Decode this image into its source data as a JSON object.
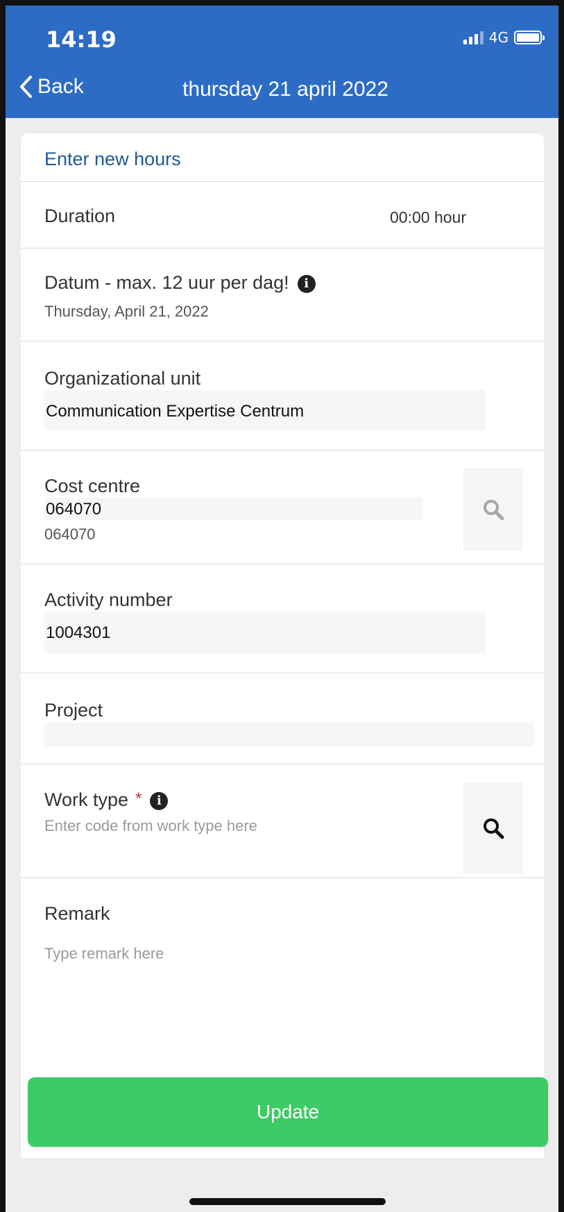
{
  "status": {
    "time": "14:19",
    "network": "4G"
  },
  "nav": {
    "back_label": "Back",
    "title": "thursday 21 april 2022"
  },
  "form": {
    "title": "Enter new hours",
    "duration": {
      "label": "Duration",
      "value": "00:00 hour"
    },
    "datum": {
      "label": "Datum - max. 12 uur per dag!",
      "value": "Thursday, April 21, 2022"
    },
    "org_unit": {
      "label": "Organizational unit",
      "value": "Communication Expertise Centrum"
    },
    "cost_centre": {
      "label": "Cost centre",
      "value": "064070",
      "description": "064070"
    },
    "activity": {
      "label": "Activity number",
      "value": "1004301"
    },
    "project": {
      "label": "Project",
      "value": ""
    },
    "work_type": {
      "label": "Work type",
      "required_mark": "*",
      "placeholder": "Enter code from work type here"
    },
    "remark": {
      "label": "Remark",
      "placeholder": "Type remark here"
    }
  },
  "actions": {
    "update_label": "Update"
  },
  "colors": {
    "header": "#2d6cc4",
    "title_text": "#1f5a99",
    "update_button": "#3ccb67",
    "required": "#c0392b"
  }
}
